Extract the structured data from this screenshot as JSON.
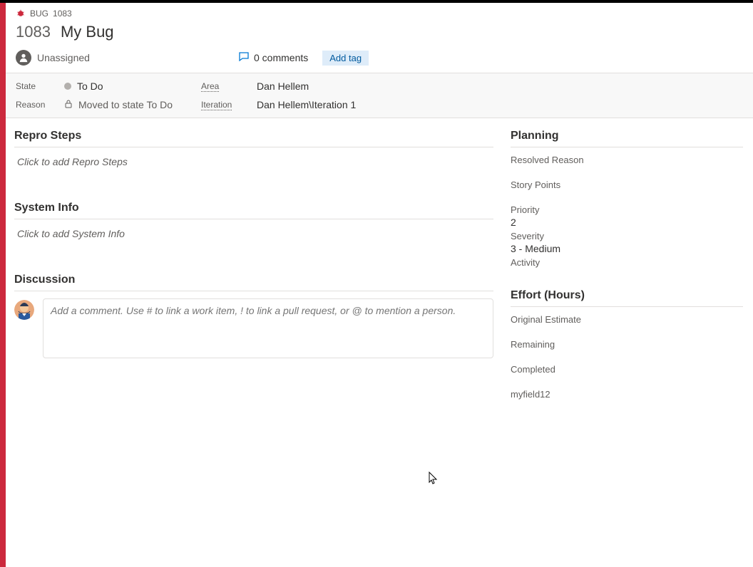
{
  "breadcrumb": {
    "type_label": "BUG",
    "id": "1083"
  },
  "workitem": {
    "id": "1083",
    "title": "My Bug"
  },
  "assignee": {
    "label": "Unassigned"
  },
  "comments_summary": "0 comments",
  "add_tag_label": "Add tag",
  "state_grid": {
    "state_label": "State",
    "state_value": "To Do",
    "reason_label": "Reason",
    "reason_value": "Moved to state To Do",
    "area_label": "Area",
    "area_value": "Dan Hellem",
    "iteration_label": "Iteration",
    "iteration_value": "Dan Hellem\\Iteration 1"
  },
  "sections": {
    "repro_header": "Repro Steps",
    "repro_placeholder": "Click to add Repro Steps",
    "sysinfo_header": "System Info",
    "sysinfo_placeholder": "Click to add System Info",
    "discussion_header": "Discussion",
    "discussion_placeholder": "Add a comment. Use # to link a work item, ! to link a pull request, or @ to mention a person."
  },
  "planning": {
    "header": "Planning",
    "resolved_reason_label": "Resolved Reason",
    "resolved_reason_value": "",
    "story_points_label": "Story Points",
    "story_points_value": "",
    "priority_label": "Priority",
    "priority_value": "2",
    "severity_label": "Severity",
    "severity_value": "3 - Medium",
    "activity_label": "Activity",
    "activity_value": ""
  },
  "effort": {
    "header": "Effort (Hours)",
    "original_estimate_label": "Original Estimate",
    "original_estimate_value": "",
    "remaining_label": "Remaining",
    "remaining_value": "",
    "completed_label": "Completed",
    "completed_value": "",
    "custom_field_label": "myfield12",
    "custom_field_value": ""
  }
}
